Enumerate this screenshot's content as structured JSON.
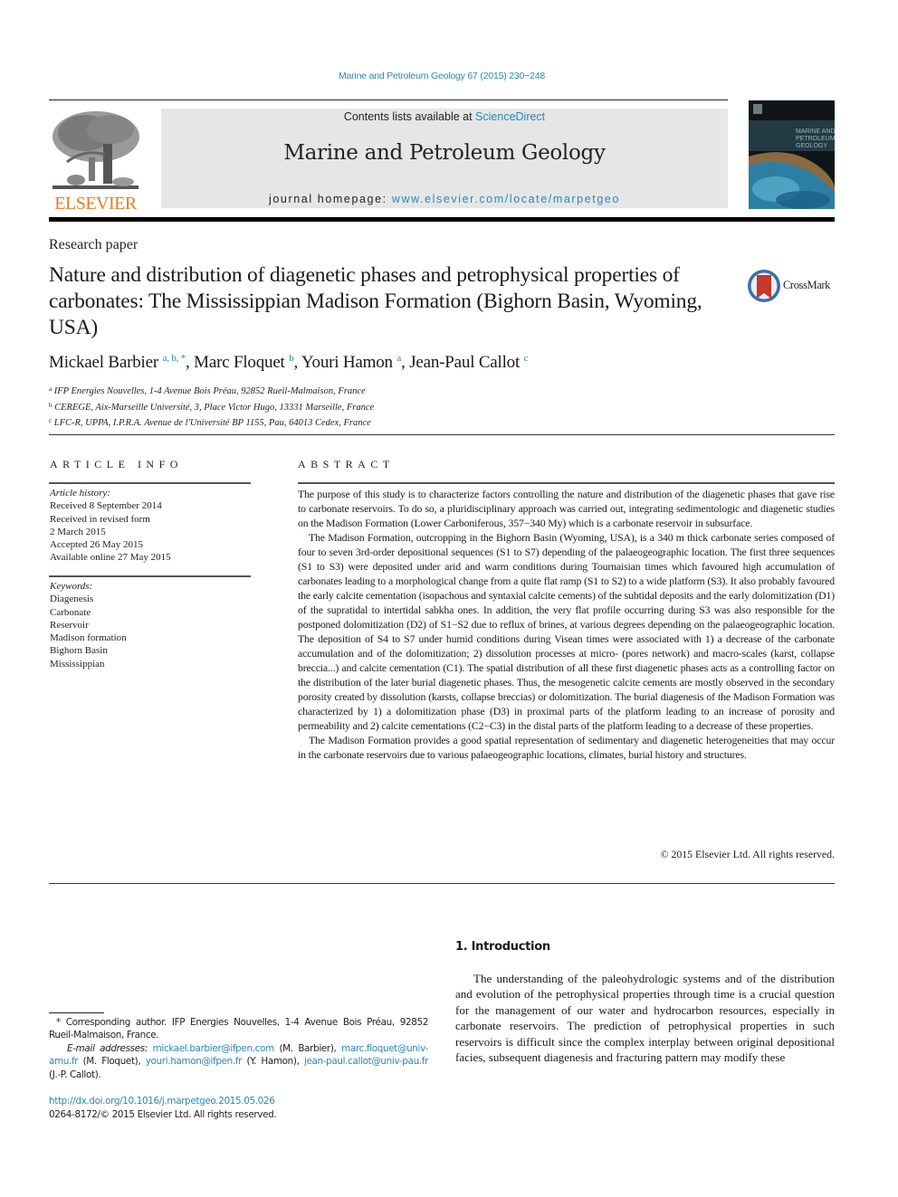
{
  "header": {
    "citation": "Marine and Petroleum Geology 67 (2015) 230−248",
    "contents_prefix": "Contents lists available at ",
    "contents_link": "ScienceDirect",
    "journal_title": "Marine and Petroleum Geology",
    "homepage_prefix": "journal homepage: ",
    "homepage_link": "www.elsevier.com/locate/marpetgeo",
    "publisher_logo_text": "ELSEVIER",
    "cover_icon": "journal-cover-image",
    "crossmark_label": "CrossMark"
  },
  "colors": {
    "link": "#2a88b8",
    "elsevier_orange": "#f0791e",
    "banner_bg": "#e6e6e6"
  },
  "article": {
    "type": "Research paper",
    "title": "Nature and distribution of diagenetic phases and petrophysical properties of carbonates: The Mississippian Madison Formation (Bighorn Basin, Wyoming, USA)",
    "authors": [
      {
        "name": "Mickael Barbier",
        "sup": "a, b, *"
      },
      {
        "name": "Marc Floquet",
        "sup": "b"
      },
      {
        "name": "Youri Hamon",
        "sup": "a"
      },
      {
        "name": "Jean-Paul Callot",
        "sup": "c"
      }
    ],
    "affiliations": [
      {
        "key": "a",
        "text": "IFP Energies Nouvelles, 1-4 Avenue Bois Préau, 92852 Rueil-Malmaison, France"
      },
      {
        "key": "b",
        "text": "CEREGE, Aix-Marseille Université, 3, Place Victor Hugo, 13331 Marseille, France"
      },
      {
        "key": "c",
        "text": "LFC-R, UPPA, I.P.R.A. Avenue de l'Université BP 1155, Pau, 64013 Cedex, France"
      }
    ]
  },
  "article_info": {
    "heading": "ARTICLE INFO",
    "history_label": "Article history:",
    "history": [
      "Received 8 September 2014",
      "Received in revised form",
      "2 March 2015",
      "Accepted 26 May 2015",
      "Available online 27 May 2015"
    ],
    "keywords_label": "Keywords:",
    "keywords": [
      "Diagenesis",
      "Carbonate",
      "Reservoir",
      "Madison formation",
      "Bighorn Basin",
      "Mississippian"
    ]
  },
  "abstract": {
    "heading": "ABSTRACT",
    "paragraphs": [
      "The purpose of this study is to characterize factors controlling the nature and distribution of the diagenetic phases that gave rise to carbonate reservoirs. To do so, a pluridisciplinary approach was carried out, integrating sedimentologic and diagenetic studies on the Madison Formation (Lower Carboniferous, 357−340 My) which is a carbonate reservoir in subsurface.",
      "The Madison Formation, outcropping in the Bighorn Basin (Wyoming, USA), is a 340 m thick carbonate series composed of four to seven 3rd-order depositional sequences (S1 to S7) depending of the palaeogeographic location. The first three sequences (S1 to S3) were deposited under arid and warm conditions during Tournaisian times which favoured high accumulation of carbonates leading to a morphological change from a quite flat ramp (S1 to S2) to a wide platform (S3). It also probably favoured the early calcite cementation (isopachous and syntaxial calcite cements) of the subtidal deposits and the early dolomitization (D1) of the supratidal to intertidal sabkha ones. In addition, the very flat profile occurring during S3 was also responsible for the postponed dolomitization (D2) of S1−S2 due to reflux of brines, at various degrees depending on the palaeogeographic location. The deposition of S4 to S7 under humid conditions during Visean times were associated with 1) a decrease of the carbonate accumulation and of the dolomitization; 2) dissolution processes at micro- (pores network) and macro-scales (karst, collapse breccia...) and calcite cementation (C1). The spatial distribution of all these first diagenetic phases acts as a controlling factor on the distribution of the later burial diagenetic phases. Thus, the mesogenetic calcite cements are mostly observed in the secondary porosity created by dissolution (karsts, collapse breccias) or dolomitization. The burial diagenesis of the Madison Formation was characterized by 1) a dolomitization phase (D3) in proximal parts of the platform leading to an increase of porosity and permeability and 2) calcite cementations (C2−C3) in the distal parts of the platform leading to a decrease of these properties.",
      "The Madison Formation provides a good spatial representation of sedimentary and diagenetic heterogeneities that may occur in the carbonate reservoirs due to various palaeogeographic locations, climates, burial history and structures."
    ],
    "copyright": "© 2015 Elsevier Ltd. All rights reserved."
  },
  "introduction": {
    "heading": "1.  Introduction",
    "text": "The understanding of the paleohydrologic systems and of the distribution and evolution of the petrophysical properties through time is a crucial question for the management of our water and hydrocarbon resources, especially in carbonate reservoirs. The prediction of petrophysical properties in such reservoirs is difficult since the complex interplay between original depositional facies, subsequent diagenesis and fracturing pattern may modify these"
  },
  "footnotes": {
    "corresponding": "* Corresponding author. IFP Energies Nouvelles, 1-4 Avenue Bois Préau, 92852 Rueil-Malmaison, France.",
    "email_label": "E-mail addresses:",
    "emails": [
      {
        "address": "mickael.barbier@ifpen.com",
        "who": " (M. Barbier), "
      },
      {
        "address": "marc.floquet@univ-amu.fr",
        "who": " (M. Floquet), "
      },
      {
        "address": "youri.hamon@ifpen.fr",
        "who": " (Y. Hamon), "
      },
      {
        "address": "jean-paul.callot@univ-pau.fr",
        "who": " (J.-P. Callot)."
      }
    ],
    "doi": "http://dx.doi.org/10.1016/j.marpetgeo.2015.05.026",
    "issn": "0264-8172/© 2015 Elsevier Ltd. All rights reserved."
  }
}
